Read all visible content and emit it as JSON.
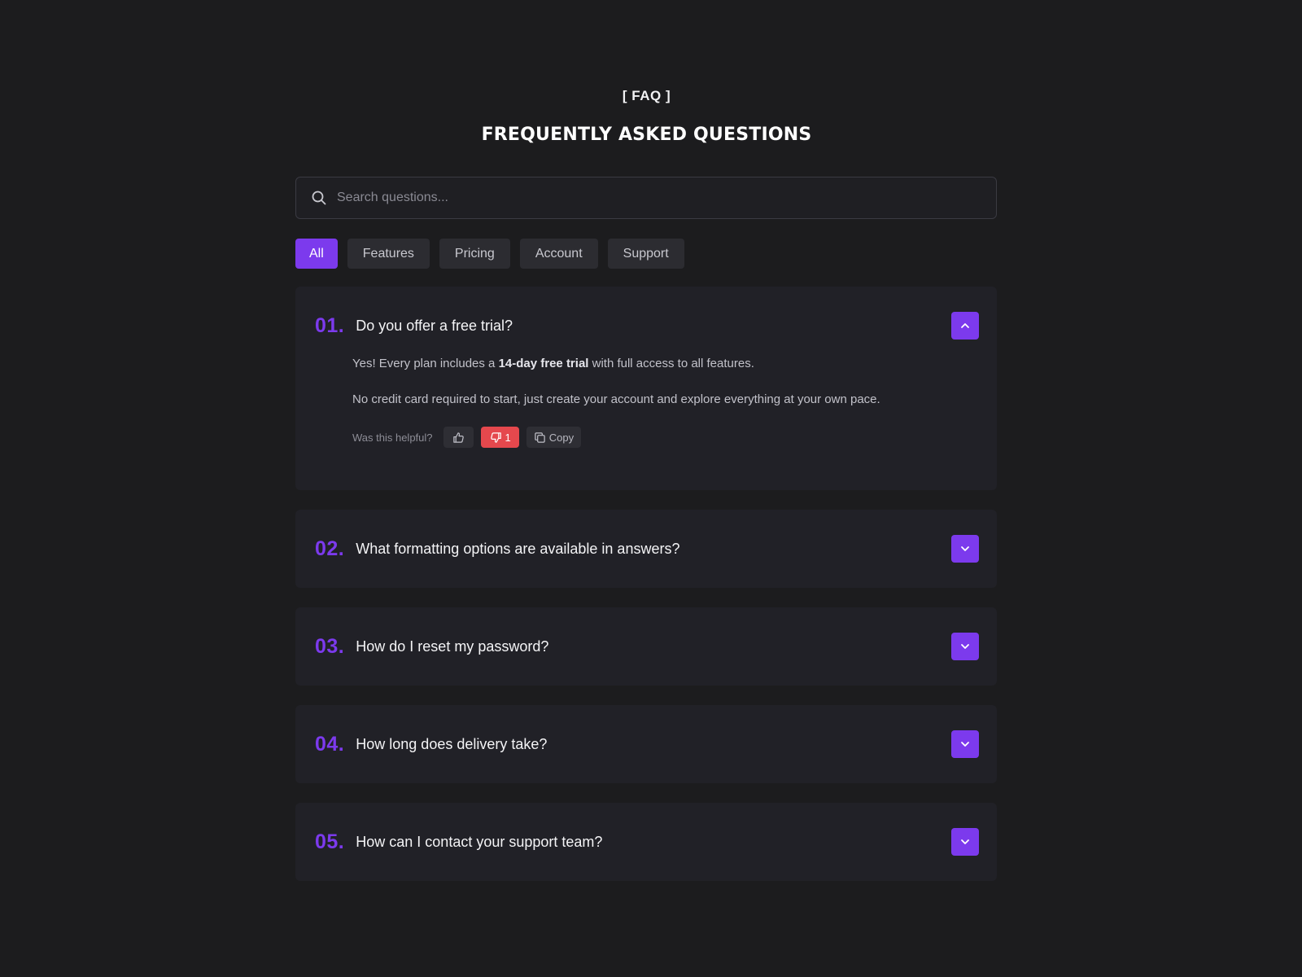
{
  "header": {
    "eyebrow": "[ FAQ ]",
    "title": "FREQUENTLY ASKED QUESTIONS"
  },
  "search": {
    "placeholder": "Search questions...",
    "value": ""
  },
  "filters": {
    "active": "All",
    "items": [
      "All",
      "Features",
      "Pricing",
      "Account",
      "Support"
    ]
  },
  "colors": {
    "accent": "#7c3aed",
    "background": "#1c1c1e",
    "card": "#212127",
    "dislike": "#e5484d"
  },
  "faqs": [
    {
      "number": "01.",
      "question": "Do you offer a free trial?",
      "expanded": true,
      "answer": {
        "p1_before": "Yes! Every plan includes a ",
        "p1_bold": "14-day free trial",
        "p1_after": " with full access to all features.",
        "p2": "No credit card required to start, just create your account and explore everything at your own pace."
      },
      "feedback": {
        "label": "Was this helpful?",
        "dislike_count": "1",
        "copy_label": "Copy"
      }
    },
    {
      "number": "02.",
      "question": "What formatting options are available in answers?",
      "expanded": false
    },
    {
      "number": "03.",
      "question": "How do I reset my password?",
      "expanded": false
    },
    {
      "number": "04.",
      "question": "How long does delivery take?",
      "expanded": false
    },
    {
      "number": "05.",
      "question": "How can I contact your support team?",
      "expanded": false
    }
  ]
}
